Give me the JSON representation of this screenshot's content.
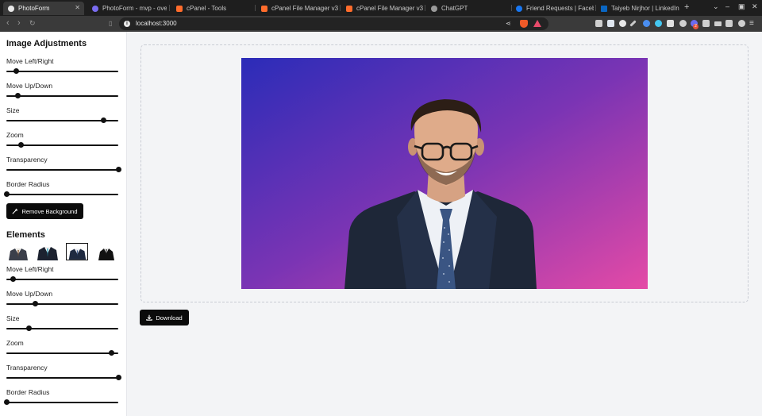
{
  "browser": {
    "tabs": [
      {
        "title": "PhotoForm",
        "active": true,
        "favicon": "photoform-icon",
        "color": "#e8e8e8"
      },
      {
        "title": "PhotoForm - mvp - over",
        "active": false,
        "favicon": "photoform-icon",
        "color": "#7a6cf0"
      },
      {
        "title": "cPanel - Tools",
        "active": false,
        "favicon": "cpanel-icon",
        "color": "#ff6c2c"
      },
      {
        "title": "cPanel File Manager v3",
        "active": false,
        "favicon": "cpanel-icon",
        "color": "#ff6c2c"
      },
      {
        "title": "cPanel File Manager v3",
        "active": false,
        "favicon": "cpanel-icon",
        "color": "#ff6c2c"
      },
      {
        "title": "ChatGPT",
        "active": false,
        "favicon": "chatgpt-icon",
        "color": "#9a9a9a"
      },
      {
        "title": "Friend Requests | Facebo",
        "active": false,
        "favicon": "facebook-icon",
        "color": "#1877f2"
      },
      {
        "title": "Taiyeb Nirjhor | LinkedIn",
        "active": false,
        "favicon": "linkedin-icon",
        "color": "#0a66c2"
      }
    ],
    "url": "localhost:3000",
    "extension_badge": "2"
  },
  "sidebar": {
    "image_adjustments": {
      "title": "Image Adjustments",
      "controls": [
        {
          "label": "Move Left/Right",
          "value_fraction": 0.09
        },
        {
          "label": "Move Up/Down",
          "value_fraction": 0.1
        },
        {
          "label": "Size",
          "value_fraction": 0.87
        },
        {
          "label": "Zoom",
          "value_fraction": 0.13
        },
        {
          "label": "Transparency",
          "value_fraction": 1.0
        },
        {
          "label": "Border Radius",
          "value_fraction": 0.0
        }
      ],
      "remove_background_label": "Remove Background"
    },
    "elements": {
      "title": "Elements",
      "options": [
        {
          "name": "suit-brown-icon",
          "selected": false
        },
        {
          "name": "suit-teal-tie-icon",
          "selected": false
        },
        {
          "name": "suit-navy-icon",
          "selected": true
        },
        {
          "name": "suit-black-icon",
          "selected": false
        }
      ],
      "controls": [
        {
          "label": "Move Left/Right",
          "value_fraction": 0.06
        },
        {
          "label": "Move Up/Down",
          "value_fraction": 0.26
        },
        {
          "label": "Size",
          "value_fraction": 0.2
        },
        {
          "label": "Zoom",
          "value_fraction": 0.94
        },
        {
          "label": "Transparency",
          "value_fraction": 1.0
        },
        {
          "label": "Border Radius",
          "value_fraction": 0.0
        }
      ]
    }
  },
  "main": {
    "download_label": "Download",
    "photo": {
      "gradient_start": "#2b2cb8",
      "gradient_mid": "#7a34b4",
      "gradient_end": "#e44aa6",
      "subject": "man-in-suit-portrait"
    }
  },
  "colors": {
    "accent": "#0b0b0b",
    "page_background": "#f3f4f6",
    "sidebar_background": "#ffffff"
  }
}
